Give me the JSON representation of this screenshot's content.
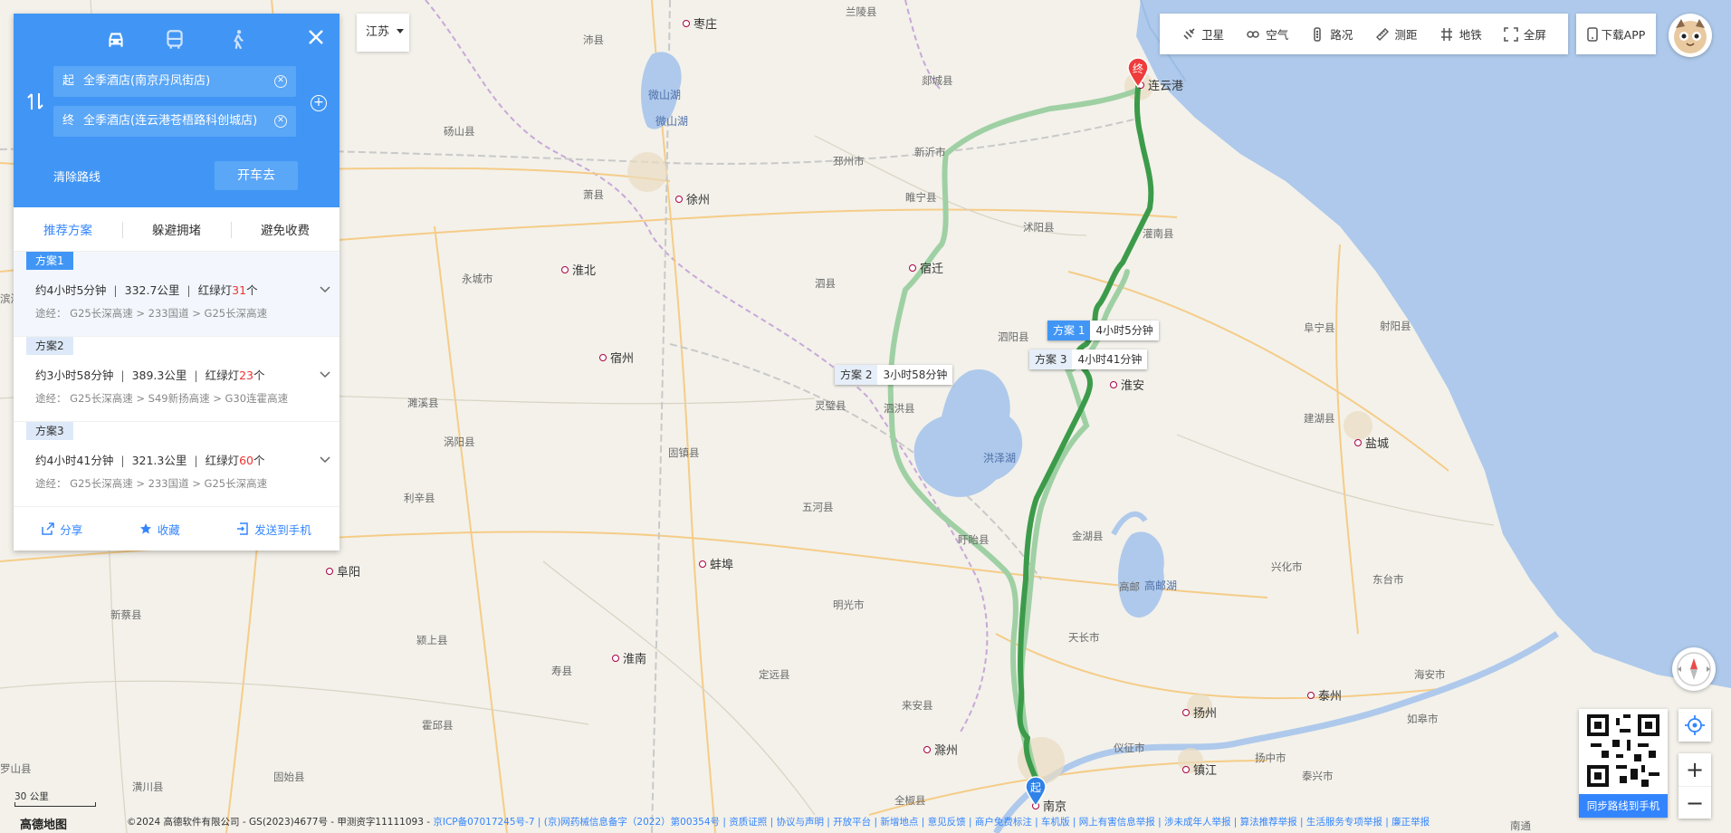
{
  "colors": {
    "accent": "#4196f5",
    "link": "#3385ff",
    "route_main": "#3c9b4a",
    "route_alt": "#9fd0a4",
    "traffic_red": "#e33333"
  },
  "panel": {
    "modes": [
      {
        "icon": "car-icon"
      },
      {
        "icon": "bus-icon"
      },
      {
        "icon": "walk-icon"
      }
    ],
    "start": {
      "tag": "起",
      "value": "全季酒店(南京丹凤街店)"
    },
    "end": {
      "tag": "终",
      "value": "全季酒店(连云港苍梧路科创城店)"
    },
    "clear_route": "清除路线",
    "go_button": "开车去",
    "add_symbol": "+",
    "tabs": [
      "推荐方案",
      "躲避拥堵",
      "避免收费"
    ],
    "routes": [
      {
        "badge": "方案1",
        "time": "约4小时5分钟",
        "distance": "332.7公里",
        "lights_label": "红绿灯",
        "lights": "31",
        "lights_unit": "个",
        "via": "途经：  G25长深高速 > 233国道 > G25长深高速"
      },
      {
        "badge": "方案2",
        "time": "约3小时58分钟",
        "distance": "389.3公里",
        "lights_label": "红绿灯",
        "lights": "23",
        "lights_unit": "个",
        "via": "途经：  G25长深高速 > S49新扬高速 > G30连霍高速"
      },
      {
        "badge": "方案3",
        "time": "约4小时41分钟",
        "distance": "321.3公里",
        "lights_label": "红绿灯",
        "lights": "60",
        "lights_unit": "个",
        "via": "途经：  G25长深高速 > 233国道 > G25长深高速"
      }
    ],
    "footer": [
      "分享",
      "收藏",
      "发送到手机"
    ]
  },
  "province": "江苏",
  "toolbar": [
    "卫星",
    "空气",
    "路况",
    "测距",
    "地铁",
    "全屏"
  ],
  "download_app": "下载APP",
  "qr_label": "同步路线到手机",
  "zoom": {
    "in": "+",
    "out": "−"
  },
  "route_tags": [
    {
      "n": "方案 1",
      "t": "4小时5分钟"
    },
    {
      "n": "方案 2",
      "t": "3小时58分钟"
    },
    {
      "n": "方案 3",
      "t": "4小时41分钟"
    }
  ],
  "markers": {
    "start": "起",
    "end": "终"
  },
  "cities": [
    "枣庄",
    "徐州",
    "淮北",
    "宿迁",
    "宿州",
    "连云港",
    "淮安",
    "盐城",
    "蚌埠",
    "阜阳",
    "淮南",
    "滁州",
    "扬州",
    "镇江",
    "泰州",
    "南京"
  ],
  "counties": [
    "沛县",
    "兰陵县",
    "郯城县",
    "砀山县",
    "新沂市",
    "邳州市",
    "萧县",
    "睢宁县",
    "沭阳县",
    "灌南县",
    "永城市",
    "泗阳县",
    "泗县",
    "阜宁县",
    "射阳县",
    "灵璧县",
    "泗洪县",
    "建湖县",
    "濉溪县",
    "涡阳县",
    "五河县",
    "固镇县",
    "利辛县",
    "盱眙县",
    "金湖县",
    "兴化市",
    "东台市",
    "明光市",
    "天长市",
    "高邮",
    "新蔡县",
    "颍上县",
    "寿县",
    "定远县",
    "来安县",
    "海安市",
    "如皋市",
    "霍邱县",
    "固始县",
    "潢川县",
    "罗山县",
    "仪征市",
    "扬中市",
    "泰兴市",
    "全椒县",
    "南通",
    "滨海县"
  ],
  "lakes": [
    "微山湖",
    "微山湖",
    "洪泽湖",
    "高邮湖"
  ],
  "scale": "30 公里",
  "logo": "高德地图",
  "footer": {
    "text": "©2024 高德软件有限公司 - GS(2023)4677号 - 甲测资字11111093 - ",
    "links": "京ICP备07017245号-7 | (京)网药械信息备字（2022）第00354号 | 资质证照 | 协议与声明 | 开放平台 | 新增地点 | 意见反馈 | 商户免费标注 | 车机版 | 网上有害信息举报 | 涉未成年人举报 | 算法推荐举报 | 生活服务专项举报 | 廉正举报"
  }
}
